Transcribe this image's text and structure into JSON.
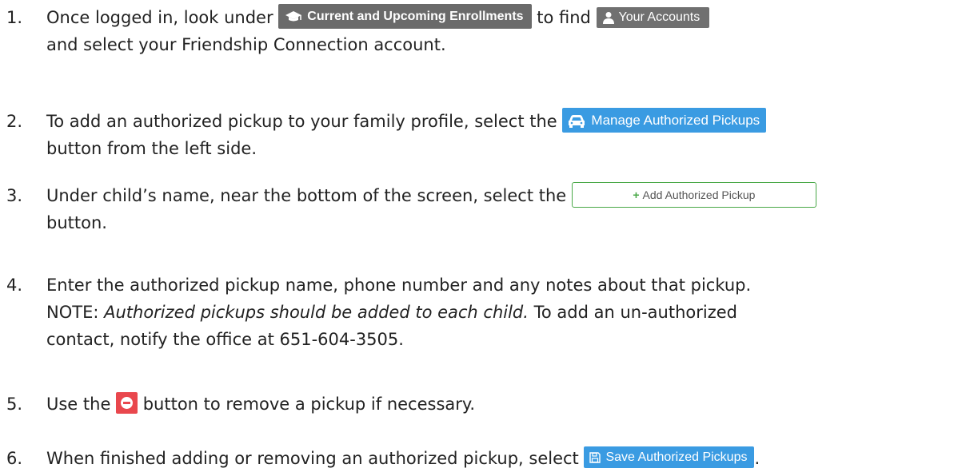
{
  "steps": [
    {
      "number": "1.",
      "text_a": "Once logged in, look under ",
      "button_a": "Current and Upcoming Enrollments",
      "text_b": " to find ",
      "button_b": "Your Accounts",
      "text_c": "and select your Friendship Connection account."
    },
    {
      "number": "2.",
      "text_a": "To add an authorized pickup to your family profile, select the ",
      "button_a": "Manage Authorized Pickups",
      "text_b": "button from the left side."
    },
    {
      "number": "3.",
      "text_a": "Under child’s name, near the bottom of the screen, select the ",
      "button_a": "Add Authorized Pickup",
      "text_b": "button."
    },
    {
      "number": "4.",
      "line1": "Enter the authorized pickup name, phone number and any notes about that pickup.",
      "note_label": "NOTE:  ",
      "note_italic": "Authorized pickups should be added to each child.",
      "note_rest": "  To add an un-authorized",
      "line3": "contact, notify the office at 651-604-3505."
    },
    {
      "number": "5.",
      "text_a": "Use the ",
      "text_b": " button to remove a pickup if necessary."
    },
    {
      "number": "6.",
      "text_a": "When finished adding or removing an authorized pickup, select ",
      "button_a": "Save Authorized Pickups",
      "text_b": "."
    }
  ],
  "icons": {
    "enrollments": "graduation-cap-icon",
    "accounts": "user-icon",
    "pickups": "car-icon",
    "add": "plus-icon",
    "remove": "minus-circle-icon",
    "save": "floppy-disk-icon"
  },
  "colors": {
    "enrollments_button": "#6a6a6a",
    "accounts_button": "#707070",
    "primary_button": "#3a9be2",
    "add_border": "#49a847",
    "remove_button": "#e9474d"
  }
}
